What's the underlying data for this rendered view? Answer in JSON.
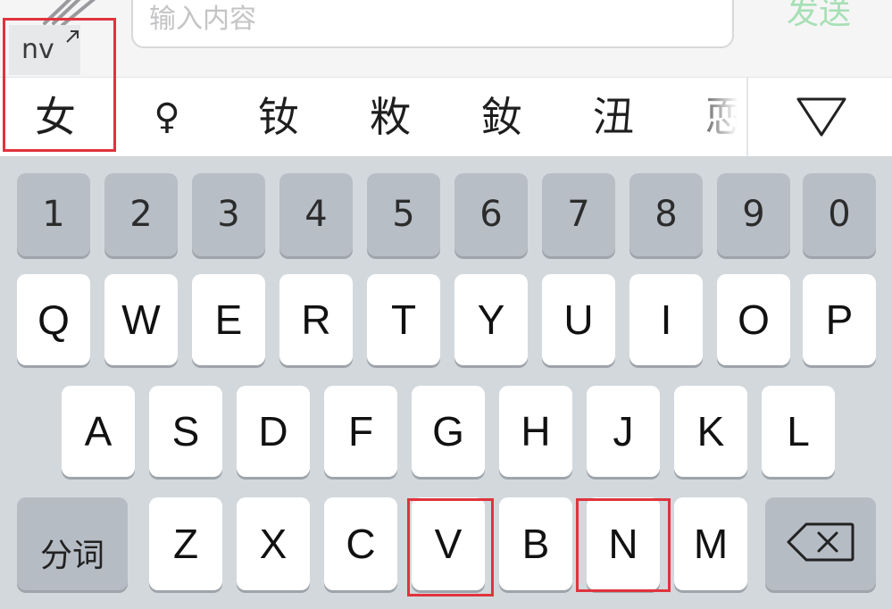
{
  "composer": {
    "placeholder": "输入内容",
    "send_label": "发送",
    "attach_icon": "paperclip-icon"
  },
  "pinyin": {
    "text": "nv",
    "expand_icon": "diagonal-arrow-icon"
  },
  "candidates": [
    "女",
    "♀",
    "钕",
    "敉",
    "釹",
    "沑",
    "恧"
  ],
  "expand_candidates_icon": "down-triangle-icon",
  "keyboard": {
    "number_row": [
      "1",
      "2",
      "3",
      "4",
      "5",
      "6",
      "7",
      "8",
      "9",
      "0"
    ],
    "row1": [
      "Q",
      "W",
      "E",
      "R",
      "T",
      "Y",
      "U",
      "I",
      "O",
      "P"
    ],
    "row2": [
      "A",
      "S",
      "D",
      "F",
      "G",
      "H",
      "J",
      "K",
      "L"
    ],
    "row3": [
      "Z",
      "X",
      "C",
      "V",
      "B",
      "N",
      "M"
    ],
    "segment_label": "分词",
    "backspace_icon": "backspace-icon"
  },
  "highlighted_keys": [
    "V",
    "N"
  ],
  "highlighted_items": [
    "nv",
    "女"
  ],
  "colors": {
    "send_label": "#a6e0b4",
    "highlight_box": "#e0333d",
    "number_key": "#b7bec6",
    "letter_key": "#ffffff"
  }
}
